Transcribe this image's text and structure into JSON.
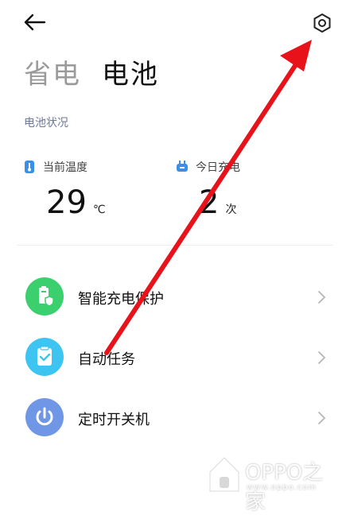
{
  "header": {
    "tabs": [
      {
        "label": "省电",
        "active": false
      },
      {
        "label": "电池",
        "active": true
      }
    ]
  },
  "battery_status": {
    "title": "电池状况",
    "stats": [
      {
        "label": "当前温度",
        "value": "29",
        "unit": "℃",
        "icon": "thermometer-icon"
      },
      {
        "label": "今日充电",
        "value": "2",
        "unit": "次",
        "icon": "plug-icon"
      }
    ]
  },
  "menu": [
    {
      "label": "智能充电保护",
      "icon": "battery-shield-icon",
      "color": "#3ccf6d"
    },
    {
      "label": "自动任务",
      "icon": "clipboard-check-icon",
      "color": "#3ec4f0"
    },
    {
      "label": "定时开关机",
      "icon": "power-icon",
      "color": "#6f97e6"
    }
  ],
  "watermark": {
    "brand": "OPPO之家",
    "site": "www.oppo.com"
  },
  "colors": {
    "accent_blue": "#3a8fe8",
    "annotation_red": "#e8121b"
  }
}
